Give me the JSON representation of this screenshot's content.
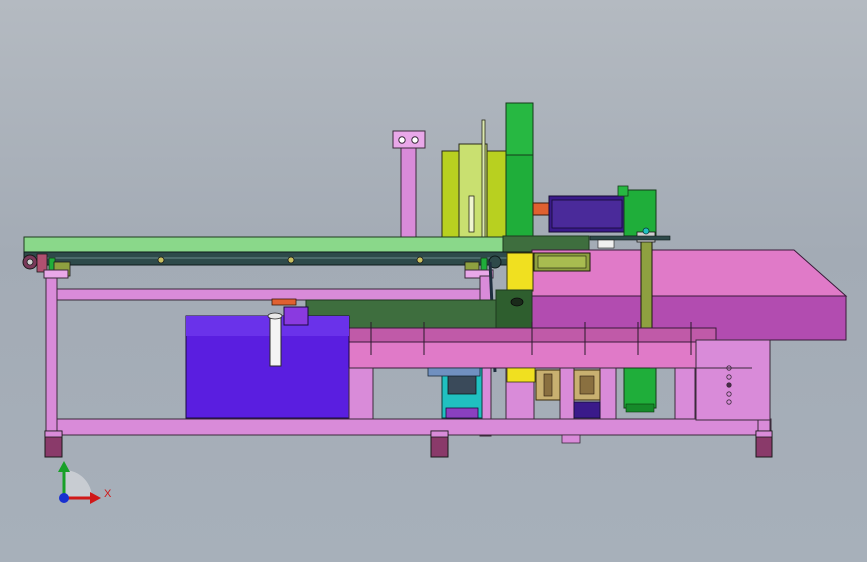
{
  "view": {
    "background_top": "#b4bac1",
    "background_bottom": "#a7b0ba"
  },
  "colors": {
    "frame": "#d98bd9",
    "frame_edge": "#3a2a3a",
    "light_green": "#8ad88a",
    "conveyor_dark": "#2e4a4a",
    "dark_green": "#3e6e3e",
    "bright_green": "#1fae3a",
    "yellow_green": "#b8d020",
    "pink": "#e07ac8",
    "magenta_dark": "#b24cb0",
    "blue_purple": "#5a1ee0",
    "navy_purple": "#3a1a8a",
    "olive": "#8ea040",
    "teal": "#20c0c0",
    "orange": "#e06030",
    "tan": "#c8b070",
    "yellow": "#f0e020"
  },
  "triad": {
    "x_label": "X",
    "x_color": "#d01818",
    "y_color": "#18a028",
    "z_color": "#1830d0"
  }
}
